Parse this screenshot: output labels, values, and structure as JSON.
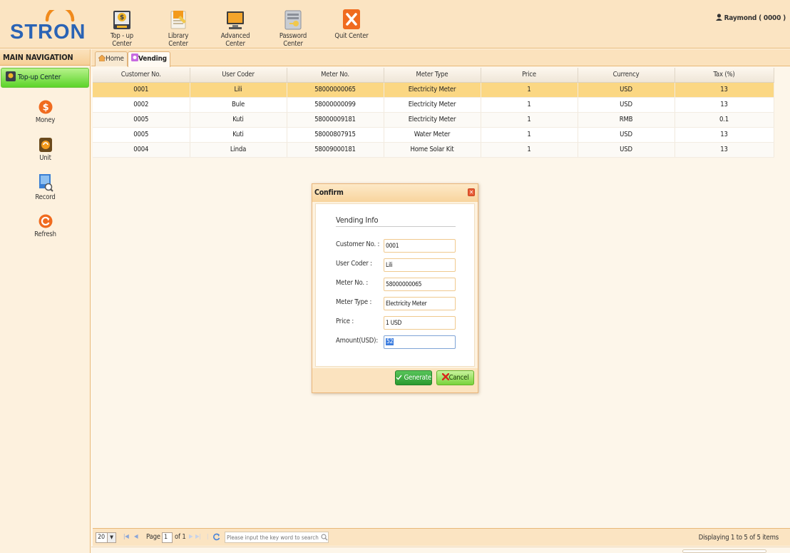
{
  "app": {
    "logo": "STRON"
  },
  "topnav": [
    {
      "label": "Top - up Center",
      "icon": "topup-icon"
    },
    {
      "label": "Library Center",
      "icon": "library-icon"
    },
    {
      "label": "Advanced Center",
      "icon": "advanced-icon"
    },
    {
      "label": "Password Center",
      "icon": "password-icon"
    },
    {
      "label": "Quit Center",
      "icon": "quit-icon"
    }
  ],
  "user": {
    "label": "Raymond ( 0000 )"
  },
  "sidebar": {
    "title": "MAIN NAVIGATION",
    "group": "Top-up Center",
    "items": [
      {
        "label": "Money",
        "icon": "money-icon"
      },
      {
        "label": "Unit",
        "icon": "unit-icon"
      },
      {
        "label": "Record",
        "icon": "record-icon"
      },
      {
        "label": "Refresh",
        "icon": "refresh-icon"
      }
    ]
  },
  "tabs": [
    {
      "label": "Home"
    },
    {
      "label": "Vending",
      "active": true
    }
  ],
  "table": {
    "columns": [
      "Customer No.",
      "User Coder",
      "Meter No.",
      "Meter Type",
      "Price",
      "Currency",
      "Tax (%)"
    ],
    "rows": [
      [
        "0001",
        "Lili",
        "58000000065",
        "Electricity Meter",
        "1",
        "USD",
        "13"
      ],
      [
        "0002",
        "Bule",
        "58000000099",
        "Electricity Meter",
        "1",
        "USD",
        "13"
      ],
      [
        "0005",
        "Kuti",
        "58000009181",
        "Electricity Meter",
        "1",
        "RMB",
        "0.1"
      ],
      [
        "0005",
        "Kuti",
        "58000807915",
        "Water Meter",
        "1",
        "USD",
        "13"
      ],
      [
        "0004",
        "Linda",
        "58009000181",
        "Home Solar Kit",
        "1",
        "USD",
        "13"
      ]
    ],
    "selected_row": 0
  },
  "dialog": {
    "title": "Confirm",
    "section": "Vending Info",
    "fields": [
      {
        "label": "Customer No. :",
        "value": "0001"
      },
      {
        "label": "User Coder :",
        "value": "Lili"
      },
      {
        "label": "Meter No. :",
        "value": "58000000065"
      },
      {
        "label": "Meter Type :",
        "value": "Electricity Meter"
      },
      {
        "label": "Price :",
        "value": "1 USD"
      },
      {
        "label": "Amount(USD):",
        "value": "52"
      }
    ],
    "generate_label": "Generate",
    "cancel_label": "Cancel"
  },
  "pager": {
    "page_size": "20",
    "page_label": "Page",
    "page_value": "1",
    "of_label": "of 1",
    "search_placeholder": "Please input the key word to search",
    "display_info": "Displaying 1 to 5 of 5 items"
  },
  "colors": {
    "header_bg": "#fbe4c2",
    "selected_row": "#fbd783",
    "nav_green": "#5cd42a",
    "logo_blue": "#2a63b5",
    "logo_orange": "#f08a1c"
  }
}
